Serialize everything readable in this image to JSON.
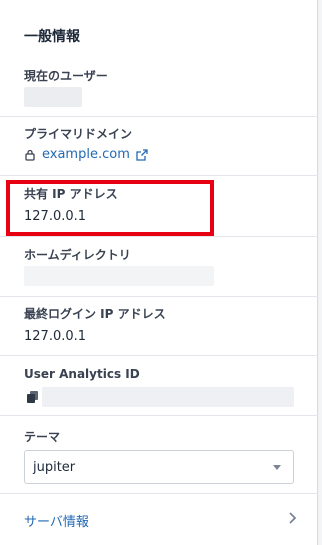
{
  "general_info": {
    "title": "一般情報",
    "current_user": {
      "label": "現在のユーザー"
    },
    "primary_domain": {
      "label": "プライマリドメイン",
      "value": "example.com",
      "link_color": "#2369b3"
    },
    "shared_ip": {
      "label": "共有 IP アドレス",
      "value": "127.0.0.1",
      "highlight_color": "#e60012"
    },
    "home_directory": {
      "label": "ホームディレクトリ"
    },
    "last_login_ip": {
      "label": "最終ログイン IP アドレス",
      "value": "127.0.0.1"
    },
    "user_analytics": {
      "label": "User Analytics ID"
    },
    "theme": {
      "label": "テーマ",
      "selected": "jupiter"
    },
    "server_info": {
      "label": "サーバ情報"
    }
  },
  "icons": [
    "lock-icon",
    "external-link-icon",
    "copy-icon",
    "chevron-down-icon",
    "chevron-right-icon"
  ]
}
